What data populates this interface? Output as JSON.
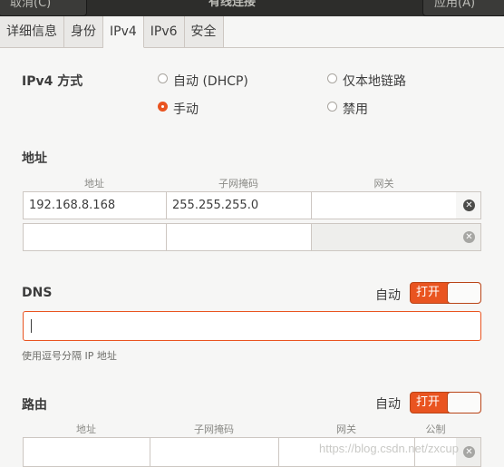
{
  "header": {
    "cancel_label": "取消(C)",
    "title": "有线连接",
    "apply_label": "应用(A)"
  },
  "tabs": [
    {
      "label": "详细信息"
    },
    {
      "label": "身份"
    },
    {
      "label": "IPv4"
    },
    {
      "label": "IPv6"
    },
    {
      "label": "安全"
    }
  ],
  "ipv4_method": {
    "label": "IPv4 方式",
    "options": {
      "dhcp": "自动 (DHCP)",
      "link_local": "仅本地链路",
      "manual": "手动",
      "disable": "禁用"
    },
    "selected": "manual"
  },
  "address": {
    "title": "地址",
    "columns": [
      "地址",
      "子网掩码",
      "网关"
    ],
    "rows": [
      [
        "192.168.8.168",
        "255.255.255.0",
        ""
      ],
      [
        "",
        "",
        ""
      ]
    ]
  },
  "dns": {
    "title": "DNS",
    "auto_label": "自动",
    "switch_label": "打开",
    "input_value": "",
    "hint": "使用逗号分隔 IP 地址"
  },
  "routes": {
    "title": "路由",
    "auto_label": "自动",
    "switch_label": "打开",
    "columns": [
      "地址",
      "子网掩码",
      "网关",
      "公制"
    ]
  },
  "icons": {
    "delete": "delete-circle-icon"
  },
  "colors": {
    "accent": "#e95420",
    "header": "#2d2d2b"
  },
  "watermark": "https://blog.csdn.net/zxcup"
}
